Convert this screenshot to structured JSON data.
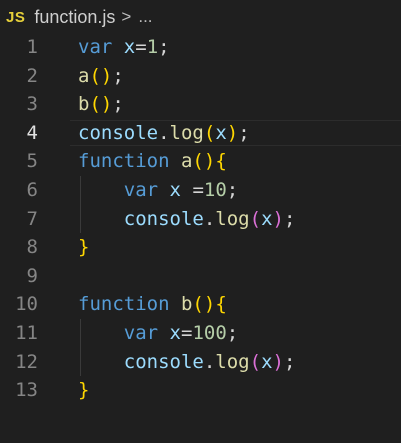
{
  "breadcrumb": {
    "language_badge": "JS",
    "file_name": "function.js",
    "separator": ">",
    "more": "..."
  },
  "editor": {
    "active_line": 4,
    "lines": [
      {
        "number": "1",
        "tokens": [
          {
            "t": "var",
            "c": "kw"
          },
          {
            "t": " ",
            "c": "p"
          },
          {
            "t": "x",
            "c": "var"
          },
          {
            "t": "=",
            "c": "p"
          },
          {
            "t": "1",
            "c": "num"
          },
          {
            "t": ";",
            "c": "p"
          }
        ]
      },
      {
        "number": "2",
        "tokens": [
          {
            "t": "a",
            "c": "fn"
          },
          {
            "t": "()",
            "c": "b1"
          },
          {
            "t": ";",
            "c": "p"
          }
        ]
      },
      {
        "number": "3",
        "tokens": [
          {
            "t": "b",
            "c": "fn"
          },
          {
            "t": "()",
            "c": "b1"
          },
          {
            "t": ";",
            "c": "p"
          }
        ]
      },
      {
        "number": "4",
        "tokens": [
          {
            "t": "console",
            "c": "var"
          },
          {
            "t": ".",
            "c": "p"
          },
          {
            "t": "log",
            "c": "fn"
          },
          {
            "t": "(",
            "c": "b1"
          },
          {
            "t": "x",
            "c": "var"
          },
          {
            "t": ")",
            "c": "b1"
          },
          {
            "t": ";",
            "c": "p"
          }
        ]
      },
      {
        "number": "5",
        "tokens": [
          {
            "t": "function",
            "c": "kw"
          },
          {
            "t": " ",
            "c": "p"
          },
          {
            "t": "a",
            "c": "fn"
          },
          {
            "t": "()",
            "c": "b1"
          },
          {
            "t": "{",
            "c": "b1"
          }
        ]
      },
      {
        "number": "6",
        "tokens": [
          {
            "t": "    ",
            "c": "p"
          },
          {
            "t": "var",
            "c": "kw"
          },
          {
            "t": " ",
            "c": "p"
          },
          {
            "t": "x",
            "c": "var"
          },
          {
            "t": " =",
            "c": "p"
          },
          {
            "t": "10",
            "c": "num"
          },
          {
            "t": ";",
            "c": "p"
          }
        ]
      },
      {
        "number": "7",
        "tokens": [
          {
            "t": "    ",
            "c": "p"
          },
          {
            "t": "console",
            "c": "var"
          },
          {
            "t": ".",
            "c": "p"
          },
          {
            "t": "log",
            "c": "fn"
          },
          {
            "t": "(",
            "c": "b2"
          },
          {
            "t": "x",
            "c": "var"
          },
          {
            "t": ")",
            "c": "b2"
          },
          {
            "t": ";",
            "c": "p"
          }
        ]
      },
      {
        "number": "8",
        "tokens": [
          {
            "t": "}",
            "c": "b1"
          }
        ]
      },
      {
        "number": "9",
        "tokens": []
      },
      {
        "number": "10",
        "tokens": [
          {
            "t": "function",
            "c": "kw"
          },
          {
            "t": " ",
            "c": "p"
          },
          {
            "t": "b",
            "c": "fn"
          },
          {
            "t": "()",
            "c": "b1"
          },
          {
            "t": "{",
            "c": "b1"
          }
        ]
      },
      {
        "number": "11",
        "tokens": [
          {
            "t": "    ",
            "c": "p"
          },
          {
            "t": "var",
            "c": "kw"
          },
          {
            "t": " ",
            "c": "p"
          },
          {
            "t": "x",
            "c": "var"
          },
          {
            "t": "=",
            "c": "p"
          },
          {
            "t": "100",
            "c": "num"
          },
          {
            "t": ";",
            "c": "p"
          }
        ]
      },
      {
        "number": "12",
        "tokens": [
          {
            "t": "    ",
            "c": "p"
          },
          {
            "t": "console",
            "c": "var"
          },
          {
            "t": ".",
            "c": "p"
          },
          {
            "t": "log",
            "c": "fn"
          },
          {
            "t": "(",
            "c": "b2"
          },
          {
            "t": "x",
            "c": "var"
          },
          {
            "t": ")",
            "c": "b2"
          },
          {
            "t": ";",
            "c": "p"
          }
        ]
      },
      {
        "number": "13",
        "tokens": [
          {
            "t": "}",
            "c": "b1"
          }
        ]
      }
    ]
  },
  "colors": {
    "background": "#1f1f1f",
    "keyword": "#569cd6",
    "variable": "#9cdcfe",
    "function": "#dcdcaa",
    "number": "#b5cea8",
    "punctuation": "#d4d4d4",
    "bracket_level1": "#ffd700",
    "bracket_level2": "#da70d6",
    "js_badge": "#e6d03a"
  }
}
